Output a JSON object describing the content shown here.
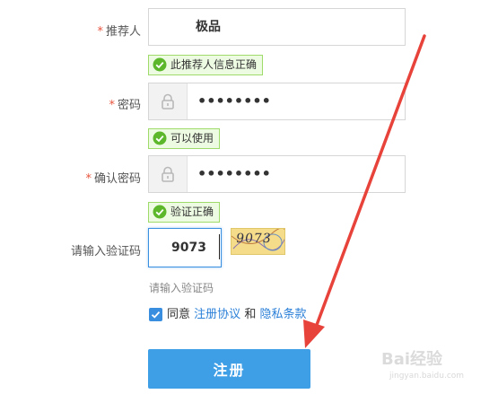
{
  "form": {
    "referrer": {
      "required_mark": "*",
      "label": "推荐人",
      "value": "极品",
      "ok_text": "此推荐人信息正确"
    },
    "password": {
      "required_mark": "*",
      "label": "密码",
      "value": "••••••••",
      "ok_text": "可以使用"
    },
    "confirm_password": {
      "required_mark": "*",
      "label": "确认密码",
      "value": "••••••••",
      "ok_text": "验证正确"
    },
    "captcha": {
      "label": "请输入验证码",
      "value": "9073",
      "image_text": "9073",
      "hint": "请输入验证码"
    },
    "agreement": {
      "checked": true,
      "prefix": "同意",
      "terms_link": "注册协议",
      "and": "和",
      "privacy_link": "隐私条款"
    },
    "submit_label": "注册"
  },
  "watermark": {
    "brand": "Bai经验",
    "url": "jingyan.baidu.com"
  },
  "colors": {
    "accent": "#3e9ee6",
    "link": "#2b80d8",
    "required": "#e8543e",
    "ok_border": "#9edb6a",
    "ok_bg": "#eefbe3",
    "arrow": "#e8433b"
  },
  "icons": {
    "lock": "lock-icon",
    "check": "check-circle-icon",
    "checkbox": "checkbox-checked-icon"
  }
}
